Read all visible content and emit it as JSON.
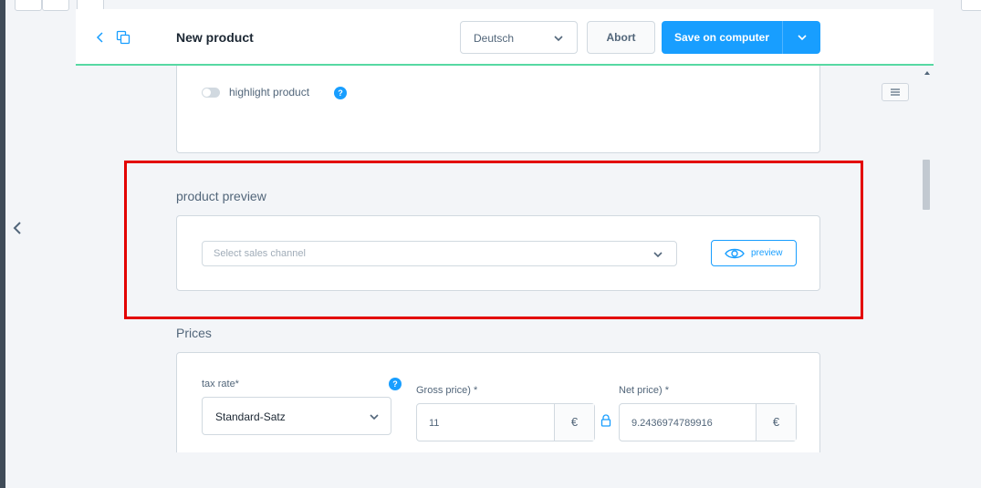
{
  "header": {
    "title": "New product",
    "language_value": "Deutsch",
    "abort_label": "Abort",
    "save_label": "Save on computer"
  },
  "highlight": {
    "toggle_label": "highlight product",
    "help_glyph": "?"
  },
  "preview_section": {
    "title": "product preview",
    "channel_placeholder": "Select sales channel",
    "preview_label": "preview"
  },
  "prices_section": {
    "title": "Prices",
    "tax_rate_label": "tax rate*",
    "tax_rate_value": "Standard-Satz",
    "gross_label": "Gross price) *",
    "gross_value": "11",
    "gross_currency": "€",
    "net_label": "Net price) *",
    "net_value": "9.2436974789916",
    "net_currency": "€",
    "help_glyph": "?"
  },
  "colors": {
    "accent": "#189eff",
    "header_border": "#57d9a3",
    "highlight_box": "#e30000"
  },
  "icons": [
    "back-arrow-icon",
    "duplicate-icon",
    "chevron-down-icon",
    "menu-icon",
    "help-icon",
    "eye-icon",
    "lock-icon",
    "chevron-left-icon"
  ]
}
